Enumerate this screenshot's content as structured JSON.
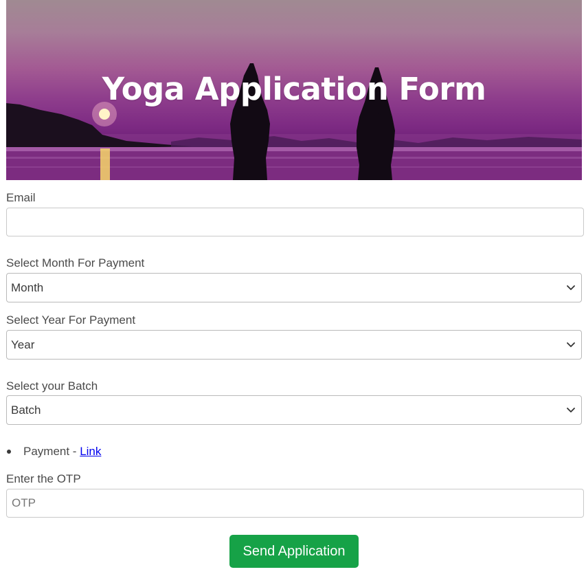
{
  "banner": {
    "title": "Yoga Application Form"
  },
  "form": {
    "email": {
      "label": "Email",
      "value": "",
      "placeholder": ""
    },
    "month": {
      "label": "Select Month For Payment",
      "selected": "Month"
    },
    "year": {
      "label": "Select Year For Payment",
      "selected": "Year"
    },
    "batch": {
      "label": "Select your Batch",
      "selected": "Batch"
    },
    "payment": {
      "text": "Payment - ",
      "link_label": "Link"
    },
    "otp": {
      "label": "Enter the OTP",
      "value": "",
      "placeholder": "OTP"
    },
    "submit_label": "Send Application"
  },
  "colors": {
    "button_green": "#16a247",
    "link_blue": "#0000ee",
    "banner_purple": "#7d2a83"
  },
  "icons": {
    "select_chevron": "chevron-down-icon"
  }
}
